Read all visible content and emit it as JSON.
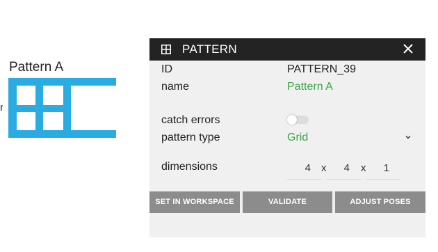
{
  "canvas": {
    "node_label": "Pattern A",
    "edge_label": "n",
    "node_color": "#2aace2"
  },
  "panel": {
    "title": "PATTERN",
    "header_icon": "grid-icon",
    "close_icon": "close-icon",
    "fields": {
      "id_label": "ID",
      "id_value": "PATTERN_39",
      "name_label": "name",
      "name_value": "Pattern A",
      "catch_errors_label": "catch errors",
      "catch_errors_on": false,
      "pattern_type_label": "pattern type",
      "pattern_type_value": "Grid",
      "dimensions_label": "dimensions",
      "dim_x": "4",
      "dim_y": "4",
      "dim_z": "1",
      "separator": "x"
    },
    "buttons": {
      "set_in_workspace": "SET IN WORKSPACE",
      "validate": "VALIDATE",
      "adjust_poses": "ADJUST POSES"
    },
    "colors": {
      "header_bg": "#232323",
      "panel_bg": "#eff0ef",
      "accent_green": "#3aa64a",
      "button_bg": "#8c8c8c"
    }
  }
}
